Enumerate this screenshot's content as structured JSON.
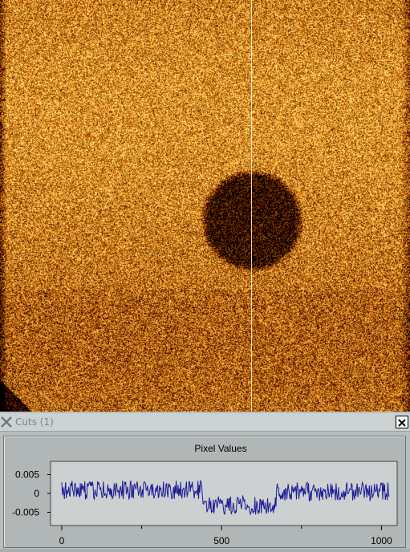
{
  "window": {
    "title": "Cuts (1)",
    "icons": {
      "app": "x-logo-icon",
      "close": "close-icon"
    }
  },
  "image_view": {
    "colormap": "heat (orange)",
    "features": [
      "dark circular object",
      "vertical bright cut line"
    ]
  },
  "colors": {
    "panel_bg": "#b1b6b6",
    "plot_bg": "#cdd0d0",
    "series_color": "#1c1c96",
    "image_dark": "#140a05",
    "image_bright": "#f0a050"
  },
  "chart_data": {
    "type": "line",
    "title": "Pixel Values",
    "xlabel": "",
    "ylabel": "",
    "xlim": [
      0,
      1024
    ],
    "ylim": [
      -0.0085,
      0.0085
    ],
    "x_ticks": [
      0,
      500,
      1000
    ],
    "x_tick_labels": [
      "0",
      "500",
      "1000"
    ],
    "y_ticks": [
      0.005,
      0,
      -0.005
    ],
    "y_tick_labels": [
      "0.005",
      "0",
      "-0.005"
    ],
    "grid": false,
    "legend": "none",
    "series": [
      {
        "levels": [
          {
            "x_start": 0,
            "x_end": 440,
            "mean": 0.0009
          },
          {
            "x_start": 440,
            "x_end": 670,
            "mean": -0.0032
          },
          {
            "x_start": 670,
            "x_end": 1024,
            "mean": 0.0005
          }
        ],
        "noise_amplitude": 0.0025
      }
    ]
  }
}
